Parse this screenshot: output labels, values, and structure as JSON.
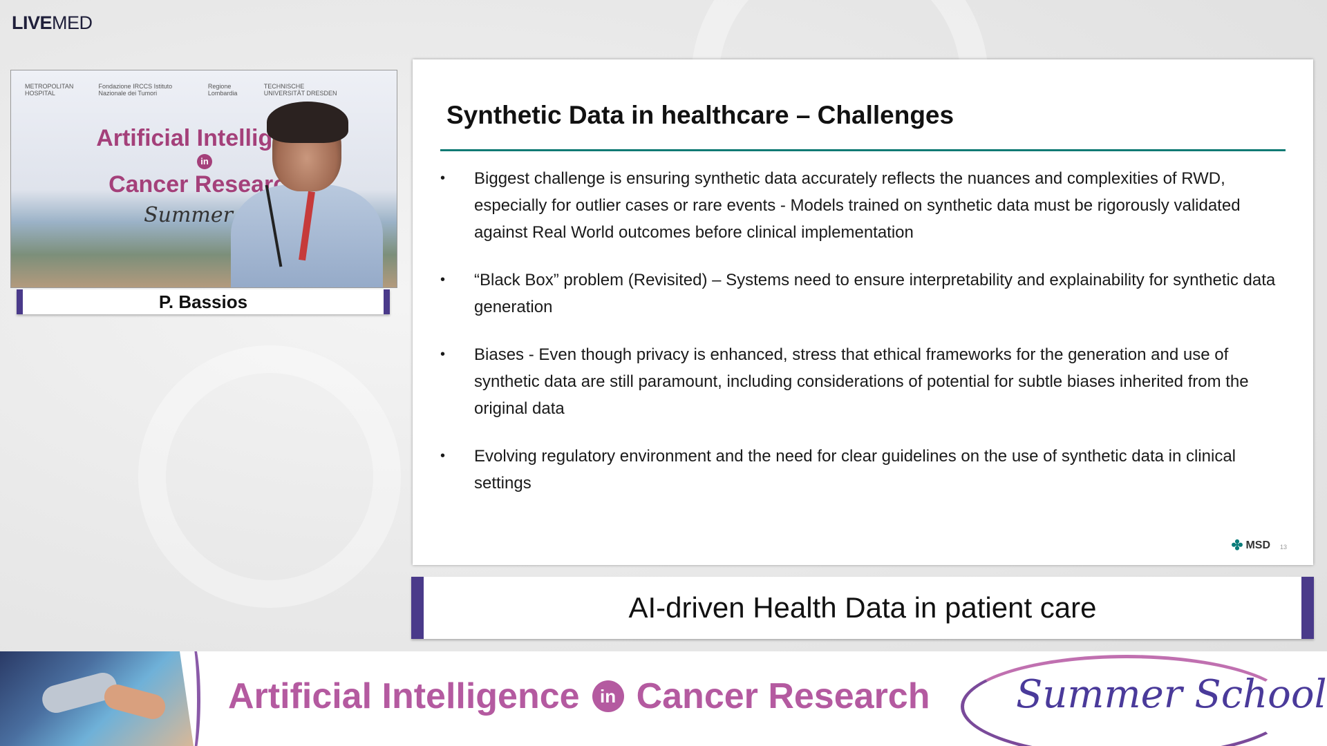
{
  "logo": {
    "bold": "LIVE",
    "light": "MED"
  },
  "video": {
    "backdrop_logos": [
      "METROPOLITAN HOSPITAL",
      "Fondazione IRCCS Istituto Nazionale dei Tumori",
      "Regione Lombardia",
      "TECHNISCHE UNIVERSITÄT DRESDEN"
    ],
    "backdrop_title_line1": "Artificial Intelligenc",
    "backdrop_in": "in",
    "backdrop_title_line2": "Cancer Research",
    "backdrop_title_line3": "Summer Sc"
  },
  "speaker": {
    "name": "P. Bassios"
  },
  "slide": {
    "title": "Synthetic Data in healthcare – Challenges",
    "bullets": [
      "Biggest challenge is ensuring synthetic data accurately reflects the nuances and complexities of RWD, especially for outlier cases or rare events - Models trained on synthetic data must be rigorously validated against Real World outcomes before clinical implementation",
      "“Black Box” problem (Revisited) – Systems need to ensure interpretability and explainability for synthetic data generation",
      "Biases - Even though privacy is enhanced, stress that ethical frameworks for the generation and use of synthetic data are still paramount, including considerations of potential for subtle biases inherited from the original data",
      "Evolving regulatory environment and the need for clear guidelines on the use of synthetic data in clinical settings"
    ],
    "brand": "MSD",
    "page_number": "13"
  },
  "caption": "AI-driven Health Data in patient care",
  "banner": {
    "title_part1": "Artificial Intelligence",
    "title_in": "in",
    "title_part2": "Cancer Research",
    "script": "Summer School"
  },
  "colors": {
    "accent_purple": "#4a3a8a",
    "teal_rule": "#0e7a74",
    "banner_pink": "#b45aa0"
  }
}
